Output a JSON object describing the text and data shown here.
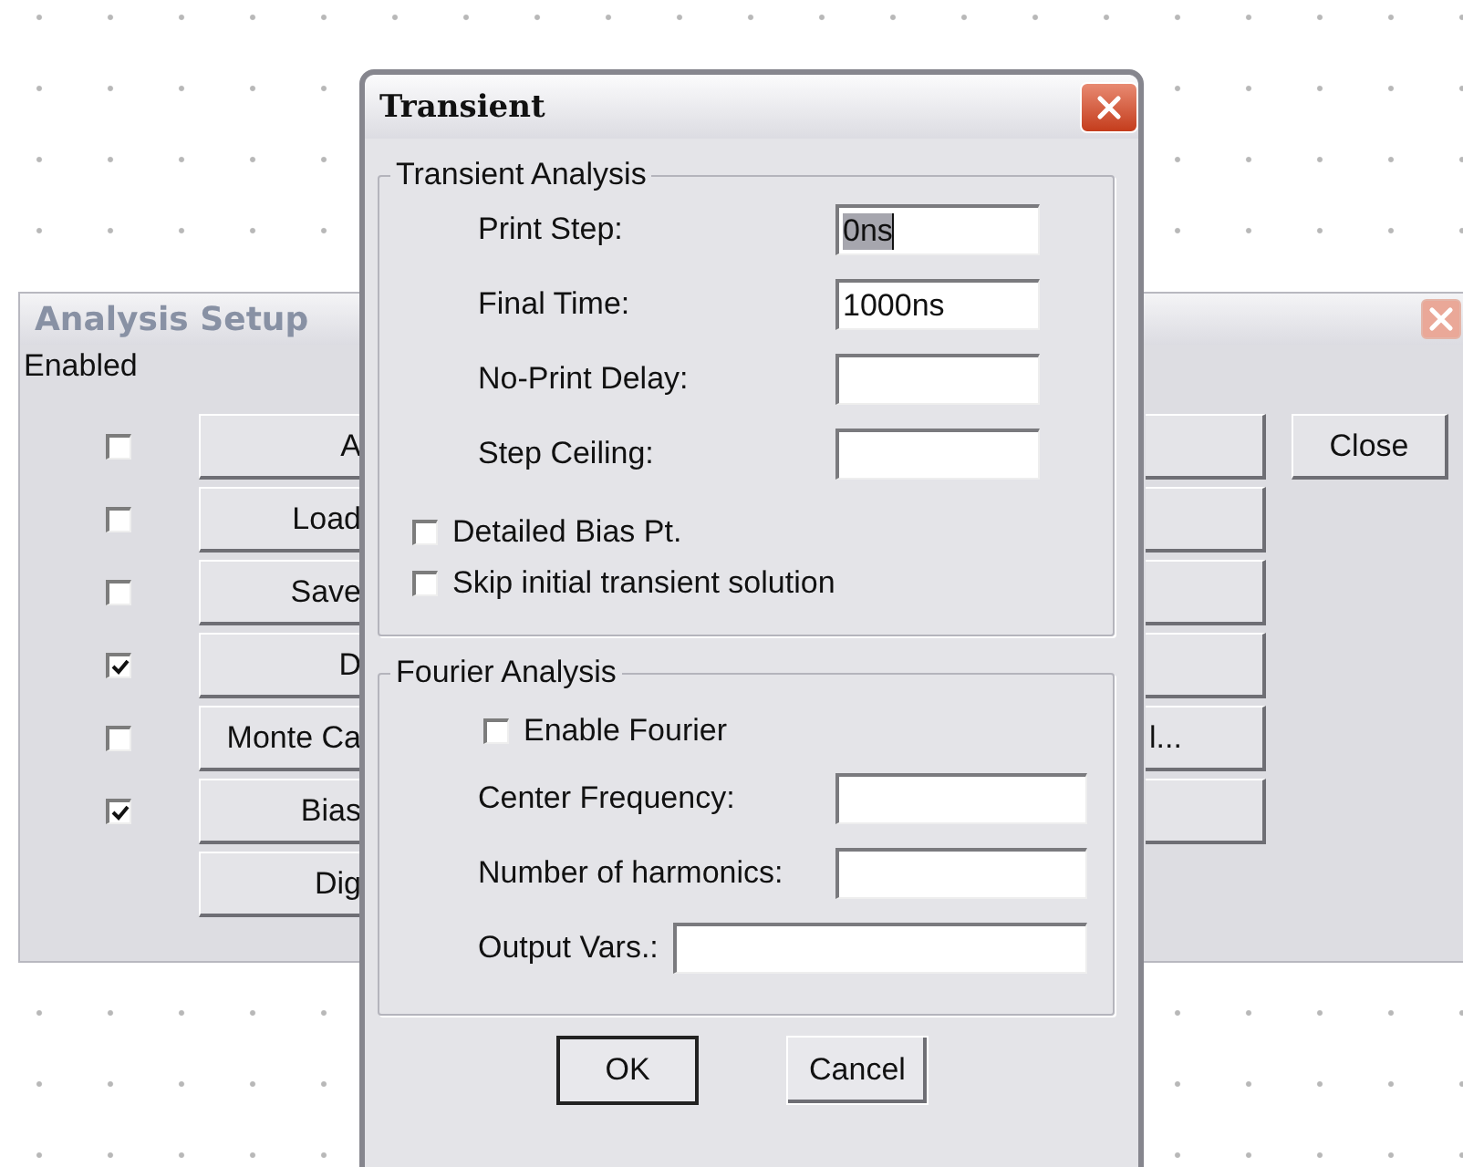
{
  "analysis_setup": {
    "title": "Analysis Setup",
    "enabled_label": "Enabled",
    "close_button": "Close",
    "rows": [
      {
        "enabled": false,
        "label": "A",
        "side_button": true
      },
      {
        "enabled": false,
        "label": "Load",
        "side_button": true
      },
      {
        "enabled": false,
        "label": "Save",
        "side_button": true
      },
      {
        "enabled": true,
        "label": "D",
        "side_button": true
      },
      {
        "enabled": false,
        "label": "Monte Ca",
        "side_button": true,
        "side_label": "l..."
      },
      {
        "enabled": true,
        "label": "Bias",
        "side_button": true
      },
      {
        "label": "Dig",
        "side_button": false
      }
    ]
  },
  "transient": {
    "title": "Transient",
    "transient_analysis": {
      "legend": "Transient Analysis",
      "fields": [
        {
          "label": "Print Step:",
          "value": "0ns",
          "text_selected": true
        },
        {
          "label": "Final Time:",
          "value": "1000ns",
          "text_selected": false
        },
        {
          "label": "No-Print Delay:"
        },
        {
          "label": "Step Ceiling:"
        }
      ],
      "checkboxes": [
        {
          "label": "Detailed Bias Pt.",
          "checked": false
        },
        {
          "label": "Skip initial transient solution",
          "checked": false
        }
      ]
    },
    "fourier_analysis": {
      "legend": "Fourier Analysis",
      "enable": {
        "label": "Enable Fourier",
        "checked": false
      },
      "fields": [
        {
          "label": "Center Frequency:",
          "kind": "short"
        },
        {
          "label": "Number of harmonics:",
          "kind": "short"
        },
        {
          "label": "Output Vars.:",
          "kind": "long"
        }
      ]
    },
    "buttons": [
      {
        "label": "OK",
        "default": true
      },
      {
        "label": "Cancel",
        "default": false
      }
    ]
  }
}
